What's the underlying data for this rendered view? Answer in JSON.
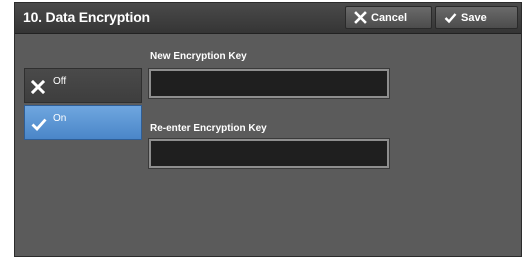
{
  "header": {
    "title": "10. Data Encryption",
    "cancel_label": "Cancel",
    "save_label": "Save"
  },
  "options": {
    "off_label": "Off",
    "on_label": "On",
    "selected": "On"
  },
  "fields": {
    "new_key_label": "New Encryption Key",
    "new_key_value": "",
    "reenter_key_label": "Re-enter Encryption Key",
    "reenter_key_value": ""
  },
  "icons": {
    "cancel": "close-icon",
    "save": "checkmark-icon",
    "off": "close-icon",
    "on": "checkmark-icon"
  },
  "colors": {
    "selected_option": "#5b96d6",
    "panel_background": "#5b5b5b",
    "field_background": "#1f1f1f"
  }
}
